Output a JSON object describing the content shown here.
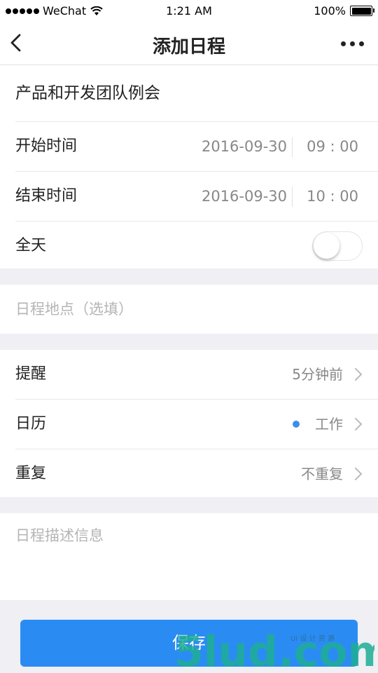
{
  "status_bar": {
    "carrier": "WeChat",
    "time": "1:21 AM",
    "battery": "100%",
    "battery_level": 1.0
  },
  "nav": {
    "title": "添加日程"
  },
  "form": {
    "event_title": "产品和开发团队例会",
    "start": {
      "label": "开始时间",
      "date": "2016-09-30",
      "time": "09 : 00"
    },
    "end": {
      "label": "结束时间",
      "date": "2016-09-30",
      "time": "10 : 00"
    },
    "all_day": {
      "label": "全天",
      "on": false
    },
    "location_placeholder": "日程地点（选填）",
    "reminder": {
      "label": "提醒",
      "value": "5分钟前"
    },
    "calendar": {
      "label": "日历",
      "value": "工作",
      "dot_color": "#3d8ee8"
    },
    "repeat": {
      "label": "重复",
      "value": "不重复"
    },
    "description_placeholder": "日程描述信息"
  },
  "save_button": "保存",
  "watermark": {
    "text": "5lud.com",
    "sub": "UI 设 计 资 源"
  },
  "colors": {
    "accent": "#2a8cf3",
    "background": "#efeff4"
  }
}
